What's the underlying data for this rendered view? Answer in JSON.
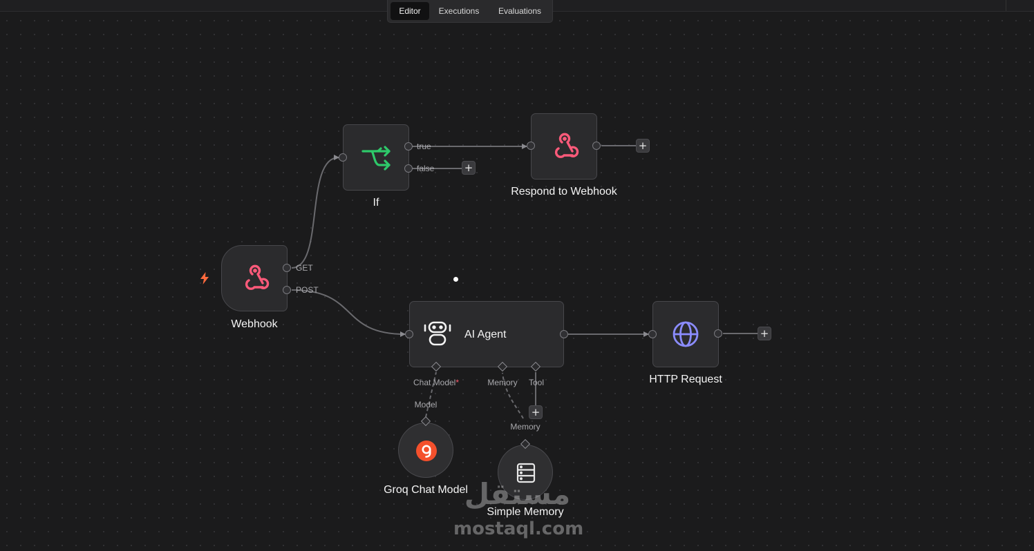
{
  "tabs": [
    {
      "label": "Editor",
      "active": true
    },
    {
      "label": "Executions",
      "active": false
    },
    {
      "label": "Evaluations",
      "active": false
    }
  ],
  "nodes": {
    "if": {
      "label": "If",
      "icon": "branch-icon",
      "outputs": [
        "true",
        "false"
      ]
    },
    "respond": {
      "label": "Respond to Webhook",
      "icon": "webhook-icon"
    },
    "webhook": {
      "label": "Webhook",
      "icon": "webhook-icon",
      "outputs": [
        "GET",
        "POST"
      ],
      "trigger_icon": "lightning-bolt-icon"
    },
    "agent": {
      "label": "AI Agent",
      "icon": "robot-icon",
      "sub_inputs": {
        "chat_model": "Chat Model",
        "required_mark": "*",
        "memory": "Memory",
        "tool": "Tool"
      }
    },
    "http": {
      "label": "HTTP Request",
      "icon": "globe-icon"
    },
    "groq": {
      "label": "Groq Chat Model",
      "icon": "groq-logo-icon",
      "connector_label": "Model"
    },
    "memory": {
      "label": "Simple Memory",
      "icon": "database-icon",
      "connector_label": "Memory"
    }
  },
  "add_button_label": "+",
  "watermark": {
    "logo_text": "مستقل",
    "url": "mostaql.com"
  },
  "colors": {
    "canvas": "#1b1b1c",
    "node_bg": "#2b2b2d",
    "webhook_icon": "#ff5a7a",
    "if_icon": "#2ec96a",
    "globe_icon": "#8b8cff",
    "trigger_bolt": "#ff6a3d",
    "groq_logo": "#f4502c"
  }
}
